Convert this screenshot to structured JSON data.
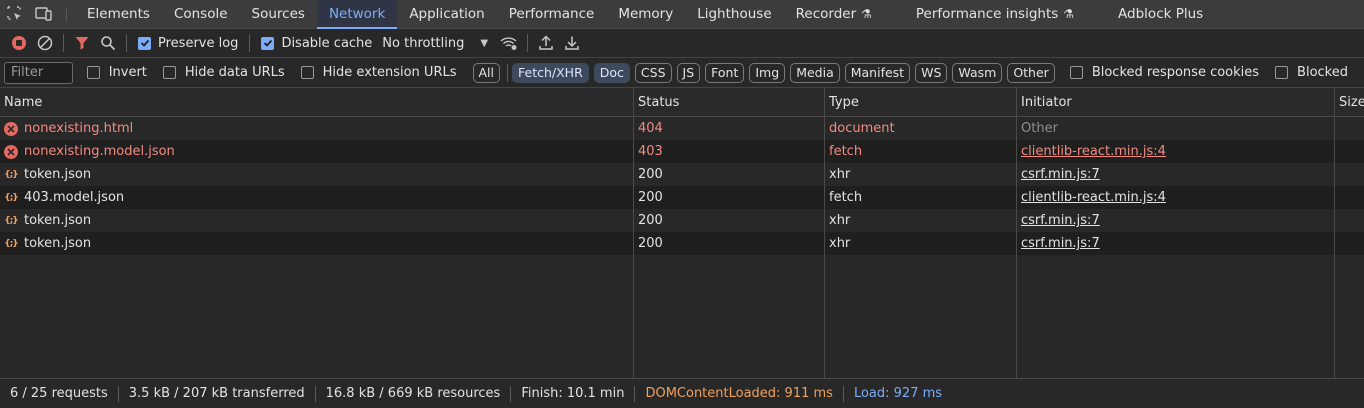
{
  "tabs": [
    {
      "label": "Elements",
      "active": false
    },
    {
      "label": "Console",
      "active": false
    },
    {
      "label": "Sources",
      "active": false
    },
    {
      "label": "Network",
      "active": true
    },
    {
      "label": "Application",
      "active": false
    },
    {
      "label": "Performance",
      "active": false
    },
    {
      "label": "Memory",
      "active": false
    },
    {
      "label": "Lighthouse",
      "active": false
    },
    {
      "label": "Recorder",
      "active": false
    },
    {
      "label": "Performance insights",
      "active": false
    },
    {
      "label": "Adblock Plus",
      "active": false
    }
  ],
  "toolbar": {
    "preserve_log_label": "Preserve log",
    "preserve_log_checked": true,
    "disable_cache_label": "Disable cache",
    "disable_cache_checked": true,
    "throttling_value": "No throttling"
  },
  "filter": {
    "placeholder": "Filter",
    "invert_label": "Invert",
    "hide_data_urls_label": "Hide data URLs",
    "hide_extension_urls_label": "Hide extension URLs",
    "blocked_response_cookies_label": "Blocked response cookies",
    "blocked_requests_label": "Blocked",
    "types": [
      {
        "label": "All",
        "selected": false
      },
      {
        "label": "Fetch/XHR",
        "selected": true
      },
      {
        "label": "Doc",
        "selected": true
      },
      {
        "label": "CSS",
        "selected": false
      },
      {
        "label": "JS",
        "selected": false
      },
      {
        "label": "Font",
        "selected": false
      },
      {
        "label": "Img",
        "selected": false
      },
      {
        "label": "Media",
        "selected": false
      },
      {
        "label": "Manifest",
        "selected": false
      },
      {
        "label": "WS",
        "selected": false
      },
      {
        "label": "Wasm",
        "selected": false
      },
      {
        "label": "Other",
        "selected": false
      }
    ]
  },
  "table": {
    "headers": {
      "name": "Name",
      "status": "Status",
      "type": "Type",
      "initiator": "Initiator",
      "size": "Size"
    },
    "rows": [
      {
        "name": "nonexisting.html",
        "status": "404",
        "type": "document",
        "initiator": "Other",
        "icon": "error-icon",
        "error": true,
        "initiator_link": false
      },
      {
        "name": "nonexisting.model.json",
        "status": "403",
        "type": "fetch",
        "initiator": "clientlib-react.min.js:4",
        "icon": "error-icon",
        "error": true,
        "initiator_link": true
      },
      {
        "name": "token.json",
        "status": "200",
        "type": "xhr",
        "initiator": "csrf.min.js:7",
        "icon": "json-icon",
        "error": false,
        "initiator_link": true
      },
      {
        "name": "403.model.json",
        "status": "200",
        "type": "fetch",
        "initiator": "clientlib-react.min.js:4",
        "icon": "json-icon",
        "error": false,
        "initiator_link": true
      },
      {
        "name": "token.json",
        "status": "200",
        "type": "xhr",
        "initiator": "csrf.min.js:7",
        "icon": "json-icon",
        "error": false,
        "initiator_link": true
      },
      {
        "name": "token.json",
        "status": "200",
        "type": "xhr",
        "initiator": "csrf.min.js:7",
        "icon": "json-icon",
        "error": false,
        "initiator_link": true
      }
    ]
  },
  "status": {
    "requests": "6 / 25 requests",
    "transferred": "3.5 kB / 207 kB transferred",
    "resources": "16.8 kB / 669 kB resources",
    "finish": "Finish: 10.1 min",
    "dom_content_loaded": "DOMContentLoaded: 911 ms",
    "load": "Load: 927 ms"
  },
  "colors": {
    "accent": "#7cacf8",
    "error": "#f28b82",
    "dcl": "#f0a05a"
  }
}
